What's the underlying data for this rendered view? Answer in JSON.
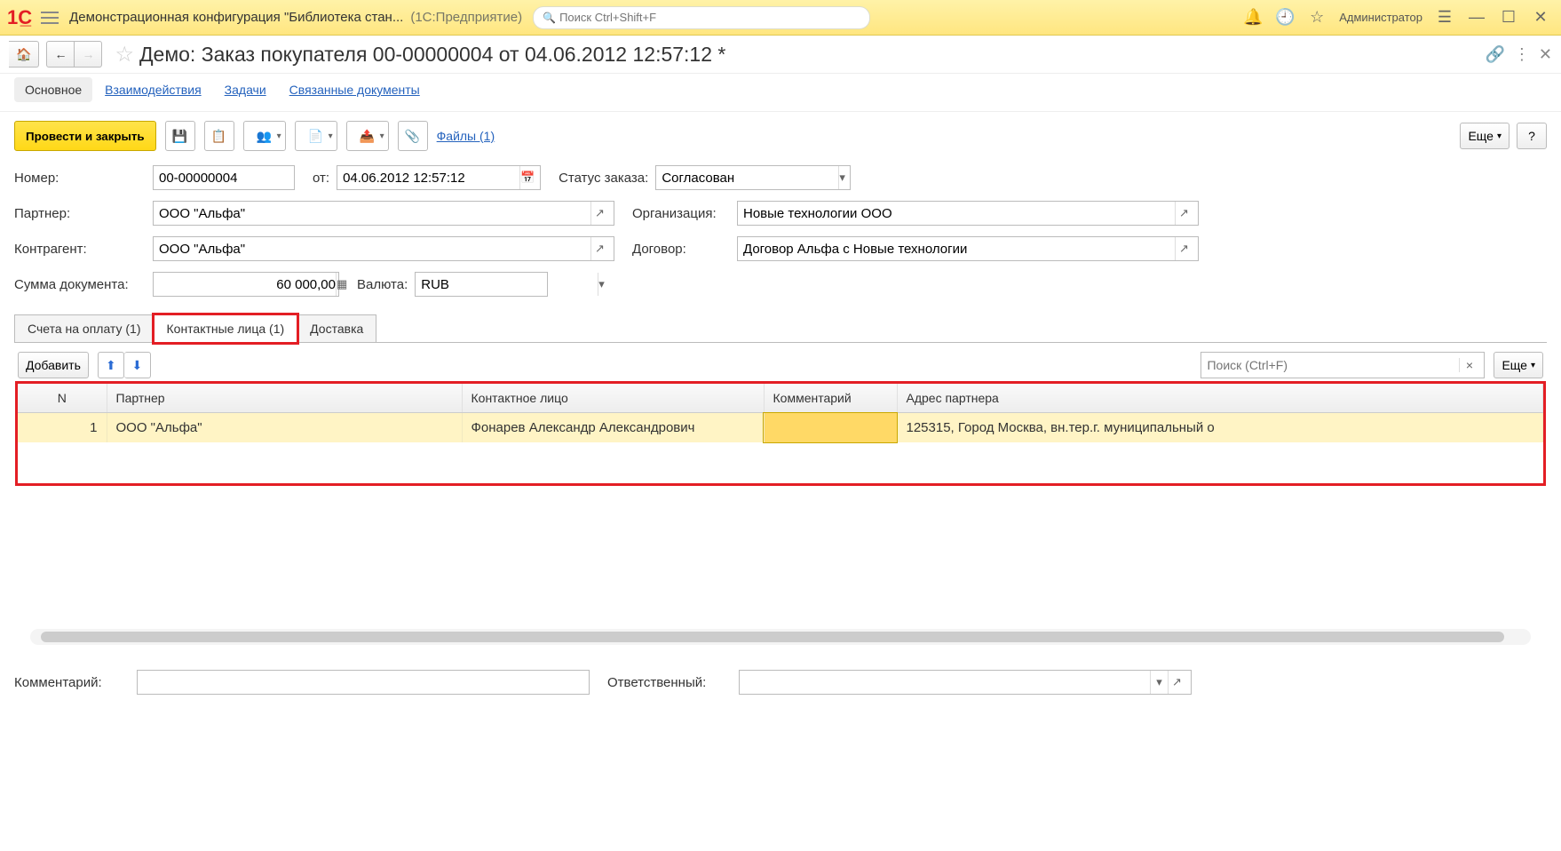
{
  "titlebar": {
    "app_name": "Демонстрационная конфигурация \"Библиотека стан...",
    "app_sub": "(1С:Предприятие)",
    "search_placeholder": "Поиск Ctrl+Shift+F",
    "user": "Администратор"
  },
  "document": {
    "title": "Демо: Заказ покупателя 00-00000004 от 04.06.2012 12:57:12 *"
  },
  "nav_tabs": [
    {
      "label": "Основное",
      "active": true
    },
    {
      "label": "Взаимодействия",
      "active": false
    },
    {
      "label": "Задачи",
      "active": false
    },
    {
      "label": "Связанные документы",
      "active": false
    }
  ],
  "toolbar": {
    "post_and_close": "Провести и закрыть",
    "files_link": "Файлы (1)",
    "more": "Еще",
    "help": "?"
  },
  "fields": {
    "number_lbl": "Номер:",
    "number": "00-00000004",
    "date_lbl": "от:",
    "date": "04.06.2012 12:57:12",
    "status_lbl": "Статус заказа:",
    "status": "Согласован",
    "partner_lbl": "Партнер:",
    "partner": "ООО \"Альфа\"",
    "org_lbl": "Организация:",
    "org": "Новые технологии ООО",
    "counterparty_lbl": "Контрагент:",
    "counterparty": "ООО \"Альфа\"",
    "contract_lbl": "Договор:",
    "contract": "Договор Альфа с Новые технологии",
    "sum_lbl": "Сумма документа:",
    "sum": "60 000,00",
    "currency_lbl": "Валюта:",
    "currency": "RUB"
  },
  "detail_tabs": [
    {
      "label": "Счета на оплату (1)"
    },
    {
      "label": "Контактные лица (1)"
    },
    {
      "label": "Доставка"
    }
  ],
  "panel_tb": {
    "add": "Добавить",
    "search_placeholder": "Поиск (Ctrl+F)",
    "more": "Еще"
  },
  "table": {
    "headers": [
      "N",
      "Партнер",
      "Контактное лицо",
      "Комментарий",
      "Адрес партнера"
    ],
    "rows": [
      {
        "n": "1",
        "partner": "ООО \"Альфа\"",
        "contact": "Фонарев Александр Александрович",
        "comment": "",
        "address": "125315, Город Москва, вн.тер.г. муниципальный о"
      }
    ]
  },
  "footer": {
    "comment_lbl": "Комментарий:",
    "comment": "",
    "responsible_lbl": "Ответственный:",
    "responsible": ""
  }
}
